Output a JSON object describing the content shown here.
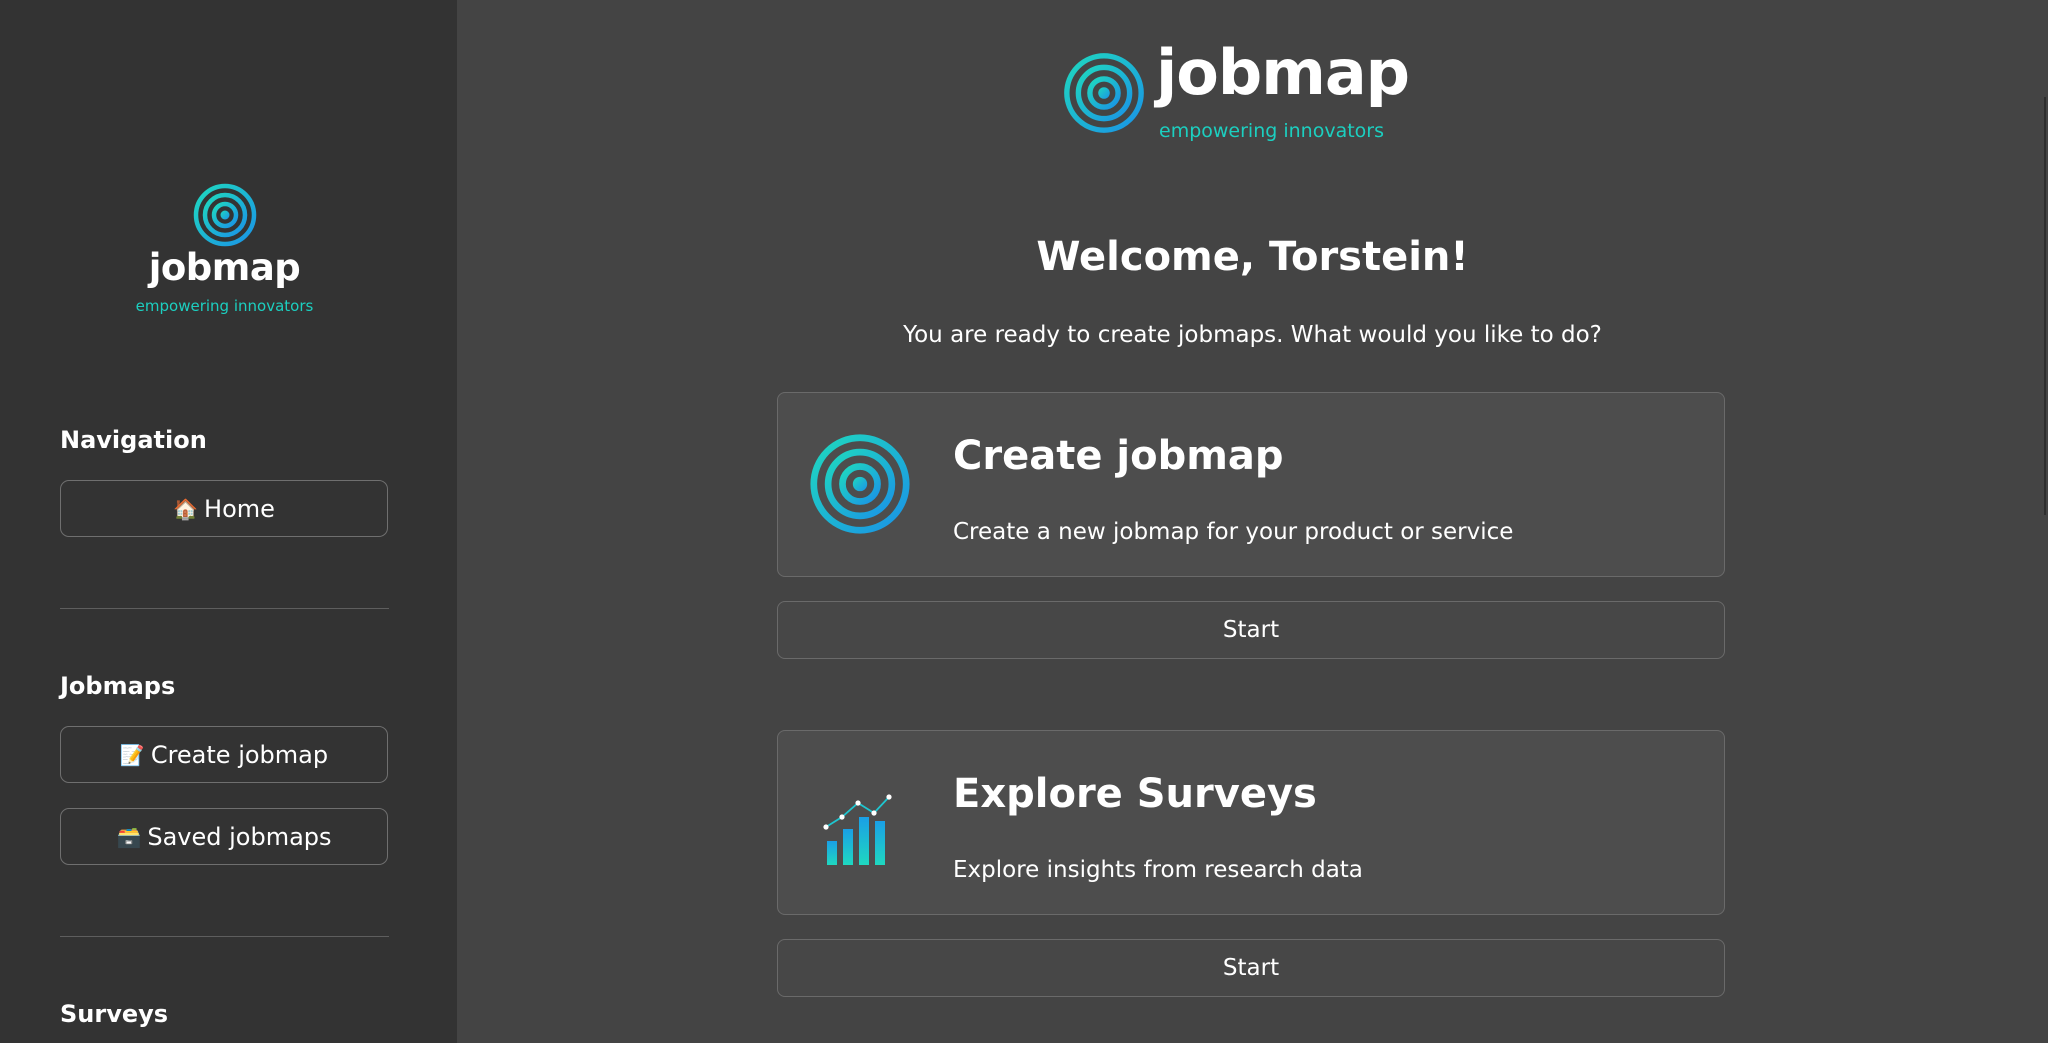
{
  "sidebar": {
    "logo": {
      "name": "jobmap",
      "tagline": "empowering innovators"
    },
    "sections": [
      {
        "title": "Navigation",
        "buttons": [
          {
            "icon": "🏠",
            "label": "Home"
          }
        ]
      },
      {
        "title": "Jobmaps",
        "buttons": [
          {
            "icon": "📝",
            "label": "Create jobmap"
          },
          {
            "icon": "🗃️",
            "label": "Saved jobmaps"
          }
        ]
      },
      {
        "title": "Surveys",
        "buttons": []
      }
    ]
  },
  "main": {
    "logo": {
      "name": "jobmap",
      "tagline": "empowering innovators"
    },
    "welcome": "Welcome, Torstein!",
    "intro": "You are ready to create jobmaps. What would you like to do?",
    "cards": [
      {
        "icon": "target-icon",
        "title": "Create jobmap",
        "description": "Create a new jobmap for your product or service",
        "button": "Start"
      },
      {
        "icon": "chart-icon",
        "title": "Explore Surveys",
        "description": "Explore insights from research data",
        "button": "Start"
      }
    ]
  },
  "colors": {
    "accent_teal": "#1ccfc0",
    "accent_blue": "#1a9fe0",
    "sidebar_bg": "#333333",
    "main_bg": "#444444"
  }
}
